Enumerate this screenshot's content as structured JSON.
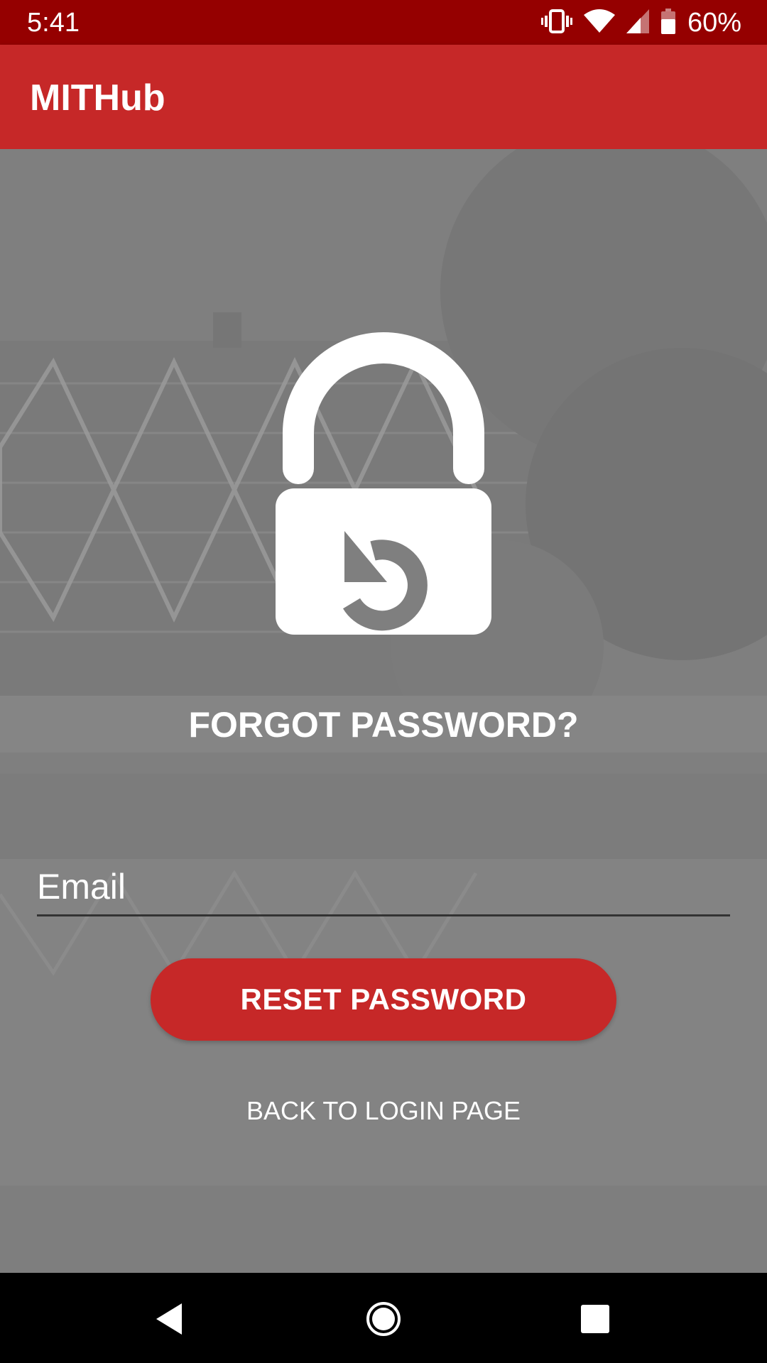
{
  "status_bar": {
    "time": "5:41",
    "battery_percent": "60%",
    "icons": [
      "vibrate-icon",
      "wifi-icon",
      "signal-icon",
      "battery-icon"
    ]
  },
  "app_bar": {
    "title": "MITHub"
  },
  "main": {
    "icon": "lock-reset-icon",
    "heading": "FORGOT PASSWORD?",
    "email_placeholder": "Email",
    "email_value": "",
    "reset_button_label": "RESET PASSWORD",
    "back_link_label": "BACK TO LOGIN PAGE"
  },
  "nav_bar": {
    "icons": [
      "back-icon",
      "home-icon",
      "recents-icon"
    ]
  },
  "colors": {
    "status_bar": "#950000",
    "app_bar": "#c62828",
    "accent_button": "#c62828",
    "background": "#808080"
  }
}
